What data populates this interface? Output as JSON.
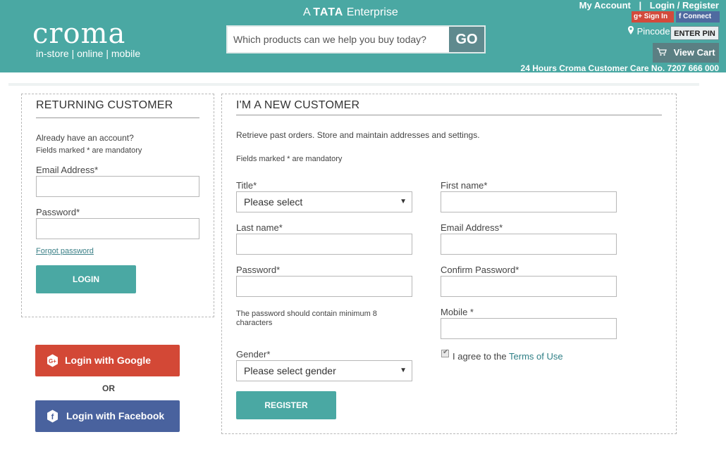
{
  "header": {
    "logo_text": "croma",
    "logo_tagline": "in-store | online | mobile",
    "tata_prefix": "A",
    "tata_brand": "TATA",
    "tata_suffix": "Enterprise",
    "search_placeholder": "Which products can we help you buy today?",
    "search_button": "GO",
    "my_account": "My Account",
    "divider": "|",
    "login_register": "Login / Register",
    "google_signin": "Sign In",
    "facebook_connect": "Connect",
    "pincode_label": "Pincode",
    "enter_pin": "ENTER PIN",
    "view_cart": "View Cart",
    "customer_care": "24 Hours Croma Customer Care No. 7207 666 000",
    "colors": {
      "header_bg": "#4aa8a3",
      "accent": "#4aa8a3"
    }
  },
  "returning": {
    "title": "RETURNING CUSTOMER",
    "intro": "Already have an account?",
    "mandatory_note": "Fields marked * are mandatory",
    "email_label": "Email Address*",
    "password_label": "Password*",
    "forgot_link": "Forgot password",
    "login_button": "LOGIN"
  },
  "social": {
    "google_button": "Login with Google",
    "or_text": "OR",
    "facebook_button": "Login with Facebook"
  },
  "new_customer": {
    "title": "I'M A NEW CUSTOMER",
    "intro": "Retrieve past orders. Store and maintain addresses and settings.",
    "mandatory_note": "Fields marked * are mandatory",
    "title_label": "Title*",
    "title_select": "Please select",
    "first_name_label": "First name*",
    "last_name_label": "Last name*",
    "email_label": "Email Address*",
    "password_label": "Password*",
    "confirm_password_label": "Confirm Password*",
    "password_hint": "The password should contain minimum 8 characters",
    "mobile_label": "Mobile *",
    "gender_label": "Gender*",
    "gender_select": "Please select gender",
    "agree_text": "I agree to the",
    "terms_link": "Terms of Use",
    "register_button": "REGISTER"
  }
}
